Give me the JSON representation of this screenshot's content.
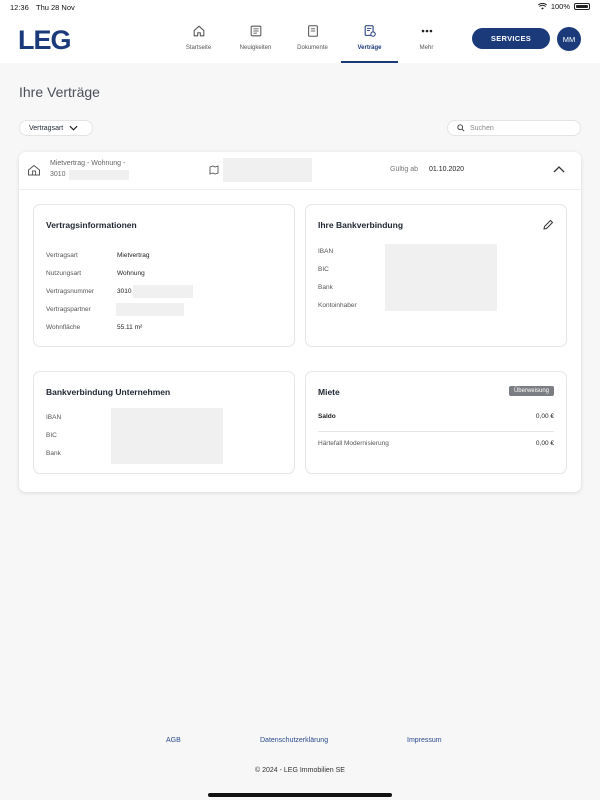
{
  "status_bar": {
    "time": "12:36",
    "date": "Thu 28 Nov",
    "battery": "100%"
  },
  "header": {
    "logo": "LEG",
    "nav": [
      {
        "label": "Startseite",
        "icon": "home-icon"
      },
      {
        "label": "Neuigkeiten",
        "icon": "newspaper-icon"
      },
      {
        "label": "Dokumente",
        "icon": "document-icon"
      },
      {
        "label": "Verträge",
        "icon": "contract-icon",
        "active": true
      },
      {
        "label": "Mehr",
        "icon": "more-icon"
      }
    ],
    "services_label": "SERVICES",
    "avatar_initials": "MM"
  },
  "page": {
    "title": "Ihre Verträge",
    "filter_label": "Vertragsart",
    "search_placeholder": "Suchen"
  },
  "contract": {
    "type": "Mietvertrag - Wohnung -",
    "number_prefix": "3010",
    "valid_label": "Gültig ab",
    "valid_date": "01.10.2020"
  },
  "vertragsinformationen": {
    "title": "Vertragsinformationen",
    "rows": [
      {
        "label": "Vertragsart",
        "value": "Mietvertrag"
      },
      {
        "label": "Nutzungsart",
        "value": "Wohnung"
      },
      {
        "label": "Vertragsnummer",
        "value": "3010"
      },
      {
        "label": "Vertragspartner",
        "value": ""
      },
      {
        "label": "Wohnfläche",
        "value": "55.11 m²"
      }
    ]
  },
  "bankverbindung": {
    "title": "Ihre Bankverbindung",
    "labels": [
      "IBAN",
      "BIC",
      "Bank",
      "Kontoinhaber"
    ]
  },
  "bankverbindung_unternehmen": {
    "title": "Bankverbindung Unternehmen",
    "labels": [
      "IBAN",
      "BIC",
      "Bank"
    ]
  },
  "miete": {
    "title": "Miete",
    "badge": "Überweisung",
    "saldo_label": "Saldo",
    "saldo_value": "0,00 €",
    "haertefall_label": "Härtefall Modernisierung",
    "haertefall_value": "0,00 €"
  },
  "footer": {
    "links": [
      "AGB",
      "Datenschutzerklärung",
      "Impressum"
    ],
    "copyright": "© 2024 - LEG Immobilien SE"
  },
  "colors": {
    "brand": "#1a3a7a",
    "background": "#f7f7f8",
    "badge": "#7a7d82"
  }
}
